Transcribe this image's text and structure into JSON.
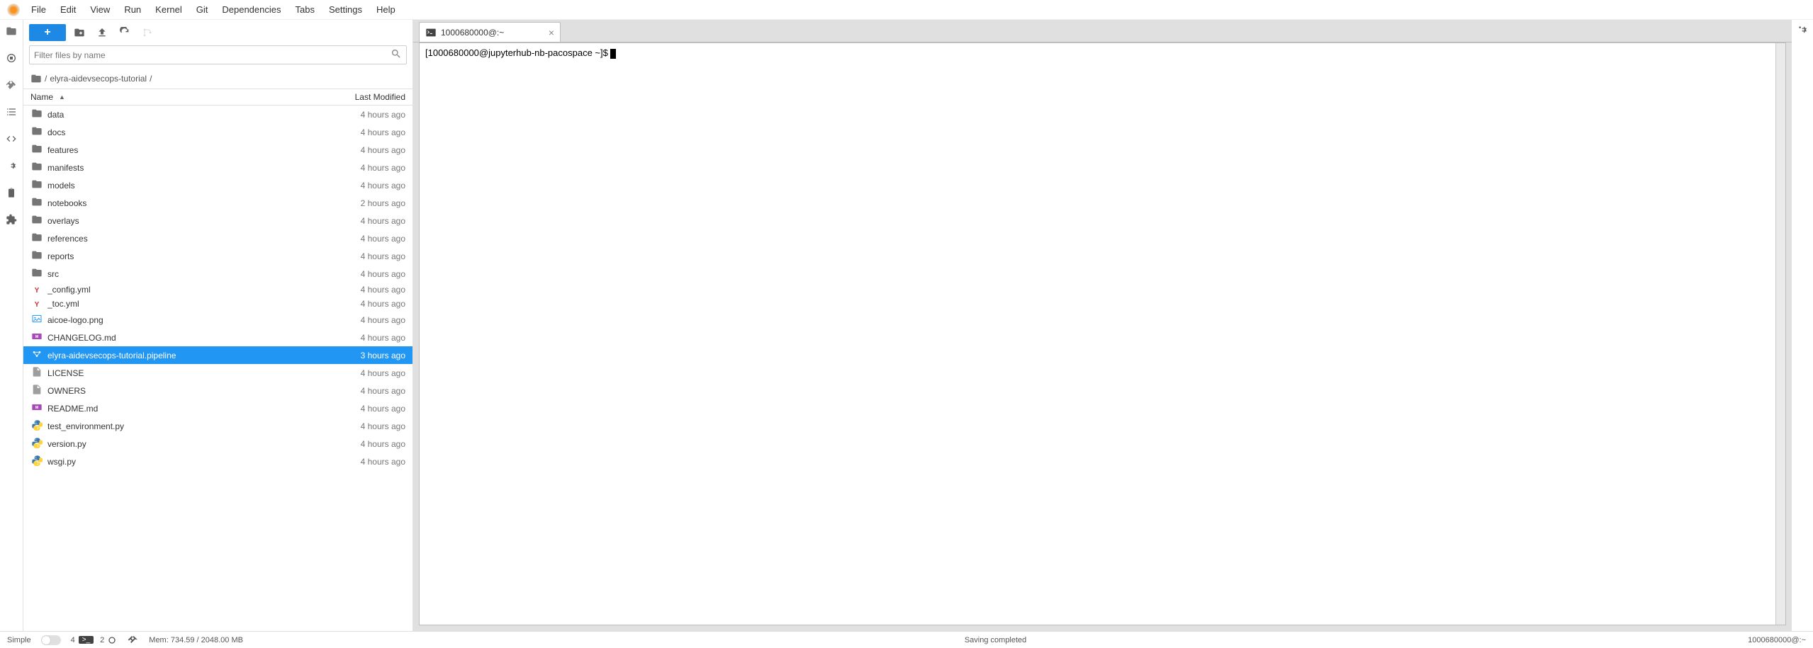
{
  "menu": [
    "File",
    "Edit",
    "View",
    "Run",
    "Kernel",
    "Git",
    "Dependencies",
    "Tabs",
    "Settings",
    "Help"
  ],
  "filebrowser": {
    "search_placeholder": "Filter files by name",
    "breadcrumb": [
      "/",
      "elyra-aidevsecops-tutorial",
      "/"
    ],
    "columns": {
      "name": "Name",
      "modified": "Last Modified"
    },
    "items": [
      {
        "icon": "folder",
        "name": "data",
        "modified": "4 hours ago"
      },
      {
        "icon": "folder",
        "name": "docs",
        "modified": "4 hours ago"
      },
      {
        "icon": "folder",
        "name": "features",
        "modified": "4 hours ago"
      },
      {
        "icon": "folder",
        "name": "manifests",
        "modified": "4 hours ago"
      },
      {
        "icon": "folder",
        "name": "models",
        "modified": "4 hours ago"
      },
      {
        "icon": "folder",
        "name": "notebooks",
        "modified": "2 hours ago"
      },
      {
        "icon": "folder",
        "name": "overlays",
        "modified": "4 hours ago"
      },
      {
        "icon": "folder",
        "name": "references",
        "modified": "4 hours ago"
      },
      {
        "icon": "folder",
        "name": "reports",
        "modified": "4 hours ago"
      },
      {
        "icon": "folder",
        "name": "src",
        "modified": "4 hours ago"
      },
      {
        "icon": "yaml",
        "name": "_config.yml",
        "modified": "4 hours ago"
      },
      {
        "icon": "yaml",
        "name": "_toc.yml",
        "modified": "4 hours ago"
      },
      {
        "icon": "image",
        "name": "aicoe-logo.png",
        "modified": "4 hours ago"
      },
      {
        "icon": "md",
        "name": "CHANGELOG.md",
        "modified": "4 hours ago"
      },
      {
        "icon": "pipeline",
        "name": "elyra-aidevsecops-tutorial.pipeline",
        "modified": "3 hours ago",
        "selected": true
      },
      {
        "icon": "text",
        "name": "LICENSE",
        "modified": "4 hours ago"
      },
      {
        "icon": "text",
        "name": "OWNERS",
        "modified": "4 hours ago"
      },
      {
        "icon": "md",
        "name": "README.md",
        "modified": "4 hours ago"
      },
      {
        "icon": "python",
        "name": "test_environment.py",
        "modified": "4 hours ago"
      },
      {
        "icon": "python",
        "name": "version.py",
        "modified": "4 hours ago"
      },
      {
        "icon": "python",
        "name": "wsgi.py",
        "modified": "4 hours ago"
      }
    ]
  },
  "tab": {
    "title": "1000680000@:~"
  },
  "terminal": {
    "prompt": "[1000680000@jupyterhub-nb-pacospace ~]$ "
  },
  "status": {
    "simple": "Simple",
    "terminals": "4",
    "kernels": "2",
    "mem": "Mem: 734.59 / 2048.00 MB",
    "center": "Saving completed",
    "right": "1000680000@:~"
  }
}
